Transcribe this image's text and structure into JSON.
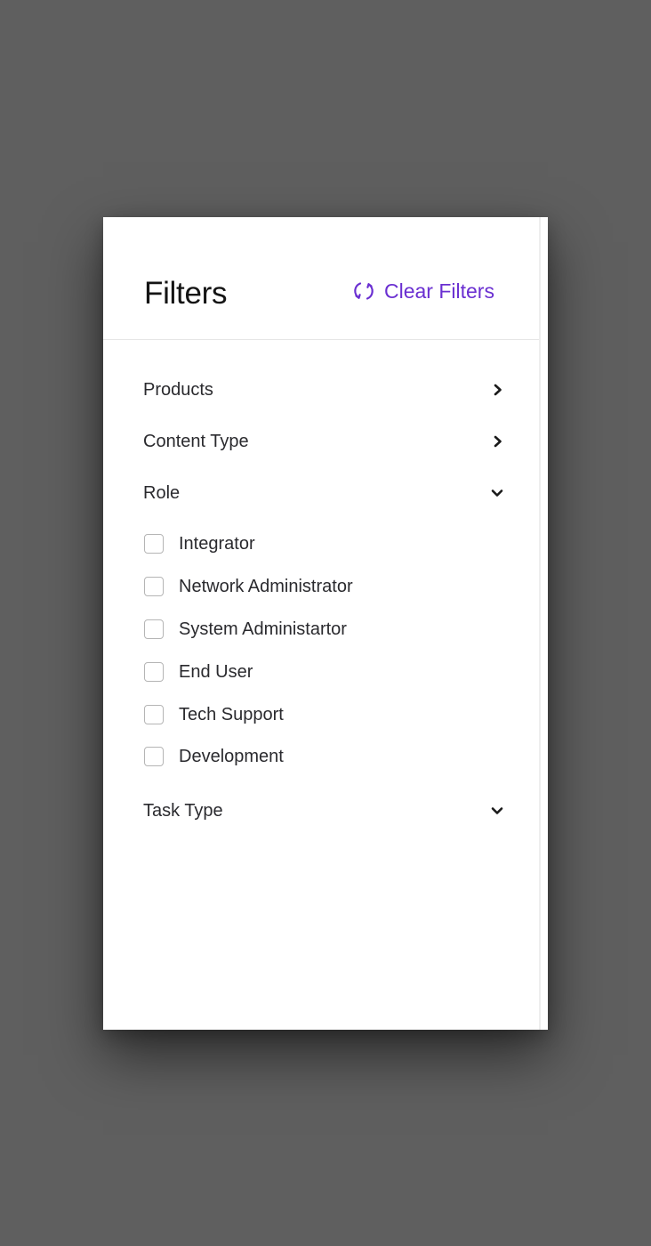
{
  "panel": {
    "title": "Filters",
    "clear_label": "Clear Filters",
    "accent_color": "#6a2fd1"
  },
  "sections": [
    {
      "label": "Products",
      "state": "collapsed",
      "icon": "chevron-right-icon"
    },
    {
      "label": "Content Type",
      "state": "collapsed",
      "icon": "chevron-right-icon"
    },
    {
      "label": "Role",
      "state": "expanded",
      "icon": "chevron-down-icon"
    },
    {
      "label": "Task Type",
      "state": "expanded",
      "icon": "chevron-down-icon"
    }
  ],
  "role_options": [
    {
      "label": "Integrator",
      "checked": false
    },
    {
      "label": "Network Administrator",
      "checked": false
    },
    {
      "label": "System Administartor",
      "checked": false
    },
    {
      "label": "End User",
      "checked": false
    },
    {
      "label": "Tech Support",
      "checked": false
    },
    {
      "label": "Development",
      "checked": false
    }
  ]
}
